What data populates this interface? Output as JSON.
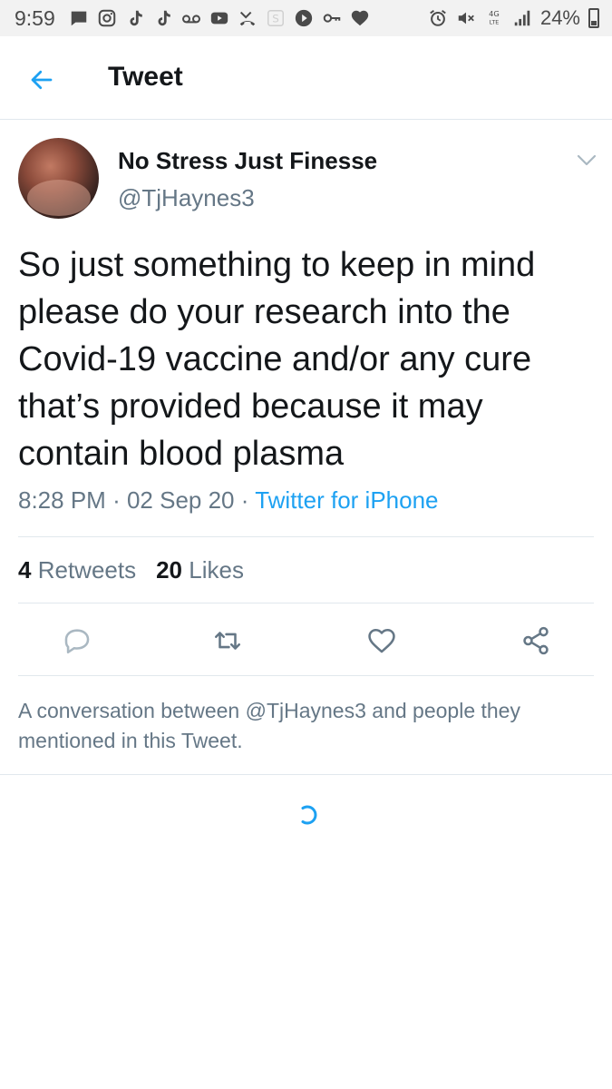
{
  "status_bar": {
    "time": "9:59",
    "battery": "24%",
    "left_icons": [
      "message-icon",
      "instagram-icon",
      "tiktok-icon",
      "tiktok-icon",
      "voicemail-icon",
      "youtube-icon",
      "missed-call-icon",
      "s-app-icon",
      "play-icon",
      "key-icon",
      "heart-icon"
    ],
    "right_icons": [
      "alarm-icon",
      "mute-icon",
      "4g-lte-icon",
      "signal-icon",
      "battery-icon"
    ]
  },
  "header": {
    "title": "Tweet",
    "accent_color": "#1da1f2"
  },
  "tweet": {
    "display_name": "No Stress Just Finesse",
    "handle": "@TjHaynes3",
    "text": "So just something to keep in mind please do your research into the Covid-19 vaccine and/or any cure that’s provided because it may contain blood plasma",
    "time": "8:28 PM",
    "date": "02 Sep 20",
    "source": "Twitter for iPhone",
    "separator": "·",
    "retweets_count": "4",
    "retweets_label": "Retweets",
    "likes_count": "20",
    "likes_label": "Likes"
  },
  "actions": [
    "reply-icon",
    "retweet-icon",
    "like-icon",
    "share-icon"
  ],
  "conversation_note": "A conversation between @TjHaynes3 and people they mentioned in this Tweet."
}
